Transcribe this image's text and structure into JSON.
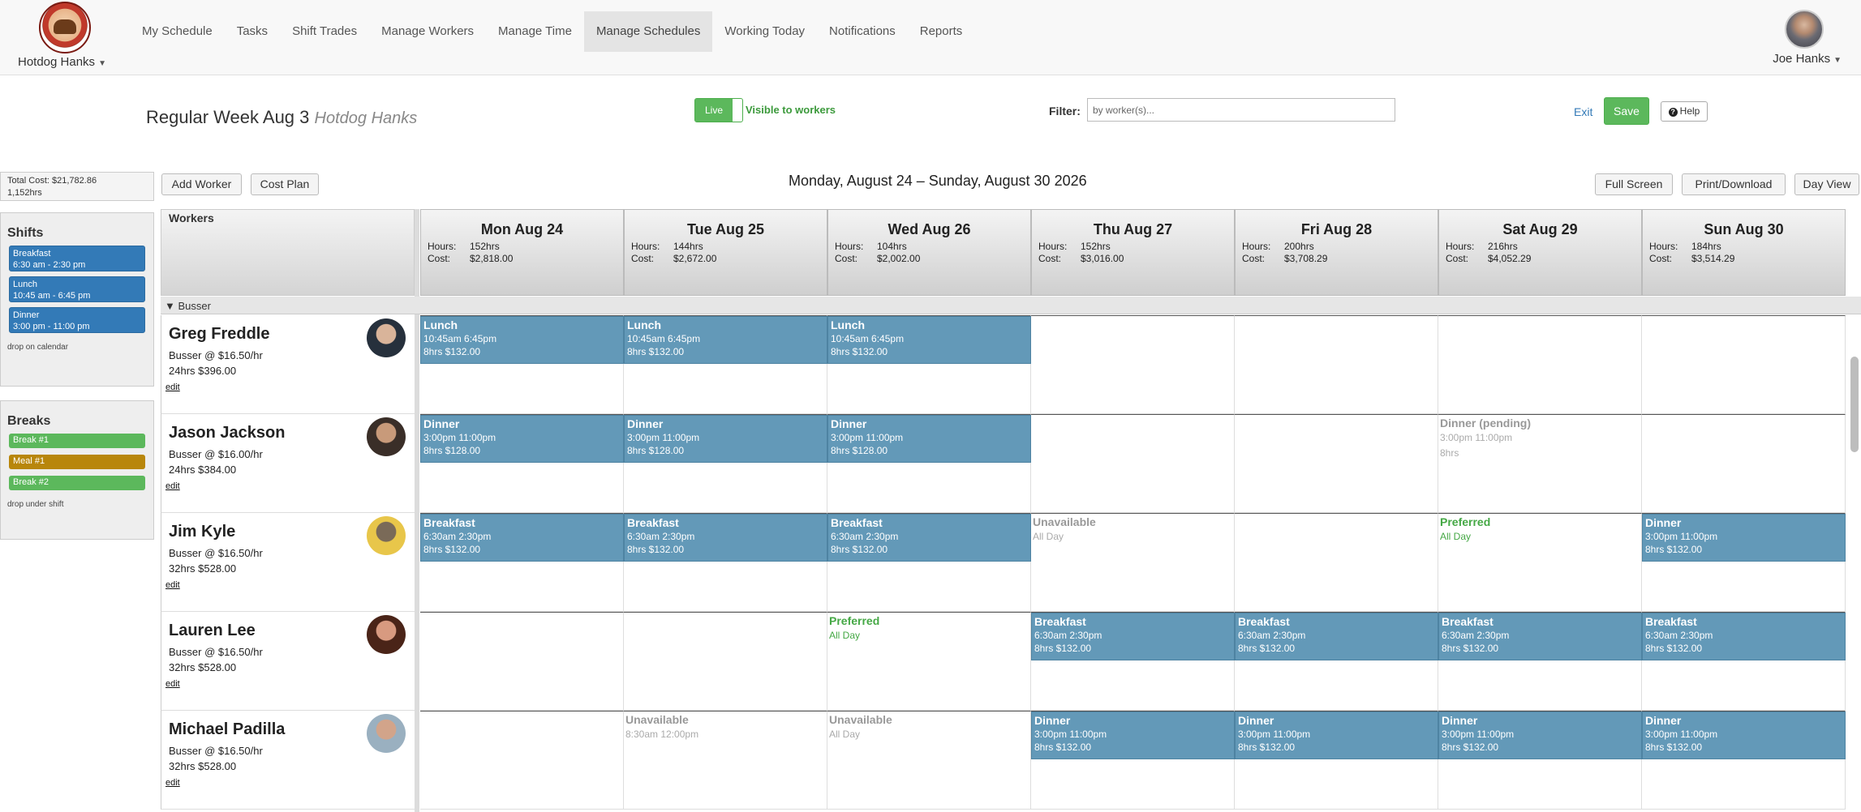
{
  "brand": {
    "name": "Hotdog Hanks"
  },
  "nav": [
    "My Schedule",
    "Tasks",
    "Shift Trades",
    "Manage Workers",
    "Manage Time",
    "Manage Schedules",
    "Working Today",
    "Notifications",
    "Reports"
  ],
  "nav_active": "Manage Schedules",
  "user": {
    "name": "Joe Hanks"
  },
  "header": {
    "title": "Regular Week Aug 3",
    "subtitle": "Hotdog Hanks",
    "live_label": "Live",
    "visible_text": "Visible to workers",
    "filter_label": "Filter:",
    "filter_placeholder": "by worker(s)...",
    "filter_value": "",
    "exit_label": "Exit",
    "save_label": "Save",
    "help_label": "Help"
  },
  "summary": {
    "total_cost": "Total Cost: $21,782.86",
    "total_hours": "1,152hrs"
  },
  "sidebar": {
    "shifts_title": "Shifts",
    "shifts": [
      {
        "name": "Breakfast",
        "time": "6:30 am - 2:30 pm"
      },
      {
        "name": "Lunch",
        "time": "10:45 am - 6:45 pm"
      },
      {
        "name": "Dinner",
        "time": "3:00 pm - 11:00 pm"
      }
    ],
    "shifts_note": "drop on calendar",
    "breaks_title": "Breaks",
    "breaks": [
      {
        "name": "Break #1",
        "color": "#5cb85c"
      },
      {
        "name": "Meal #1",
        "color": "#b8860b"
      },
      {
        "name": "Break #2",
        "color": "#5cb85c"
      }
    ],
    "breaks_note": "drop under shift"
  },
  "toolbar": {
    "add_worker": "Add Worker",
    "cost_plan": "Cost Plan",
    "date_range": "Monday, August 24 – Sunday, August 30 2026",
    "full_screen": "Full Screen",
    "print_download": "Print/Download",
    "day_view": "Day View"
  },
  "grid": {
    "workers_header": "Workers",
    "hours_label": "Hours:",
    "cost_label": "Cost:",
    "group": "▼ Busser",
    "days": [
      {
        "name": "Mon Aug 24",
        "hours": "152hrs",
        "cost": "$2,818.00"
      },
      {
        "name": "Tue Aug 25",
        "hours": "144hrs",
        "cost": "$2,672.00"
      },
      {
        "name": "Wed Aug 26",
        "hours": "104hrs",
        "cost": "$2,002.00"
      },
      {
        "name": "Thu Aug 27",
        "hours": "152hrs",
        "cost": "$3,016.00"
      },
      {
        "name": "Fri Aug 28",
        "hours": "200hrs",
        "cost": "$3,708.29"
      },
      {
        "name": "Sat Aug 29",
        "hours": "216hrs",
        "cost": "$4,052.29"
      },
      {
        "name": "Sun Aug 30",
        "hours": "184hrs",
        "cost": "$3,514.29"
      }
    ],
    "workers": [
      {
        "name": "Greg Freddle",
        "role": "Busser @ $16.50/hr",
        "totals": "24hrs $396.00",
        "edit": "edit",
        "avatar": [
          "#26303c",
          "#d9b49a"
        ],
        "days": [
          {
            "kind": "shift",
            "name": "Lunch",
            "time": "10:45am 6:45pm",
            "cost": "8hrs $132.00"
          },
          {
            "kind": "shift",
            "name": "Lunch",
            "time": "10:45am 6:45pm",
            "cost": "8hrs $132.00"
          },
          {
            "kind": "shift",
            "name": "Lunch",
            "time": "10:45am 6:45pm",
            "cost": "8hrs $132.00"
          },
          {
            "kind": "empty"
          },
          {
            "kind": "empty"
          },
          {
            "kind": "empty"
          },
          {
            "kind": "empty"
          }
        ]
      },
      {
        "name": "Jason Jackson",
        "role": "Busser @ $16.00/hr",
        "totals": "24hrs $384.00",
        "edit": "edit",
        "avatar": [
          "#3a2e28",
          "#c89a7a"
        ],
        "days": [
          {
            "kind": "shift",
            "name": "Dinner",
            "time": "3:00pm 11:00pm",
            "cost": "8hrs $128.00"
          },
          {
            "kind": "shift",
            "name": "Dinner",
            "time": "3:00pm 11:00pm",
            "cost": "8hrs $128.00"
          },
          {
            "kind": "shift",
            "name": "Dinner",
            "time": "3:00pm 11:00pm",
            "cost": "8hrs $128.00"
          },
          {
            "kind": "empty"
          },
          {
            "kind": "empty"
          },
          {
            "kind": "status",
            "tone": "gray",
            "name": "Dinner (pending)",
            "sub": "3:00pm 11:00pm",
            "sub2": "8hrs"
          },
          {
            "kind": "empty"
          }
        ]
      },
      {
        "name": "Jim Kyle",
        "role": "Busser @ $16.50/hr",
        "totals": "32hrs $528.00",
        "edit": "edit",
        "avatar": [
          "#e8c64a",
          "#7a6a58"
        ],
        "days": [
          {
            "kind": "shift",
            "name": "Breakfast",
            "time": "6:30am 2:30pm",
            "cost": "8hrs $132.00"
          },
          {
            "kind": "shift",
            "name": "Breakfast",
            "time": "6:30am 2:30pm",
            "cost": "8hrs $132.00"
          },
          {
            "kind": "shift",
            "name": "Breakfast",
            "time": "6:30am 2:30pm",
            "cost": "8hrs $132.00"
          },
          {
            "kind": "status",
            "tone": "gray",
            "name": "Unavailable",
            "sub": "All Day"
          },
          {
            "kind": "empty"
          },
          {
            "kind": "status",
            "tone": "green",
            "name": "Preferred",
            "sub": "All Day"
          },
          {
            "kind": "shift",
            "name": "Dinner",
            "time": "3:00pm 11:00pm",
            "cost": "8hrs $132.00"
          }
        ]
      },
      {
        "name": "Lauren Lee",
        "role": "Busser @ $16.50/hr",
        "totals": "32hrs $528.00",
        "edit": "edit",
        "avatar": [
          "#4a2418",
          "#d89a80"
        ],
        "days": [
          {
            "kind": "empty"
          },
          {
            "kind": "empty"
          },
          {
            "kind": "status",
            "tone": "green",
            "name": "Preferred",
            "sub": "All Day"
          },
          {
            "kind": "shift",
            "name": "Breakfast",
            "time": "6:30am 2:30pm",
            "cost": "8hrs $132.00"
          },
          {
            "kind": "shift",
            "name": "Breakfast",
            "time": "6:30am 2:30pm",
            "cost": "8hrs $132.00"
          },
          {
            "kind": "shift",
            "name": "Breakfast",
            "time": "6:30am 2:30pm",
            "cost": "8hrs $132.00"
          },
          {
            "kind": "shift",
            "name": "Breakfast",
            "time": "6:30am 2:30pm",
            "cost": "8hrs $132.00"
          }
        ]
      },
      {
        "name": "Michael Padilla",
        "role": "Busser @ $16.50/hr",
        "totals": "32hrs $528.00",
        "edit": "edit",
        "avatar": [
          "#9ab0c0",
          "#d2a48a"
        ],
        "days": [
          {
            "kind": "empty"
          },
          {
            "kind": "status",
            "tone": "gray",
            "name": "Unavailable",
            "sub": "8:30am 12:00pm"
          },
          {
            "kind": "status",
            "tone": "gray",
            "name": "Unavailable",
            "sub": "All Day"
          },
          {
            "kind": "shift",
            "name": "Dinner",
            "time": "3:00pm 11:00pm",
            "cost": "8hrs $132.00"
          },
          {
            "kind": "shift",
            "name": "Dinner",
            "time": "3:00pm 11:00pm",
            "cost": "8hrs $132.00"
          },
          {
            "kind": "shift",
            "name": "Dinner",
            "time": "3:00pm 11:00pm",
            "cost": "8hrs $132.00"
          },
          {
            "kind": "shift",
            "name": "Dinner",
            "time": "3:00pm 11:00pm",
            "cost": "8hrs $132.00"
          }
        ]
      }
    ]
  },
  "colors": {
    "accent_green": "#5cb85c",
    "shift_block": "#6399b8",
    "chip_blue": "#337ab7",
    "link": "#337ab7"
  }
}
